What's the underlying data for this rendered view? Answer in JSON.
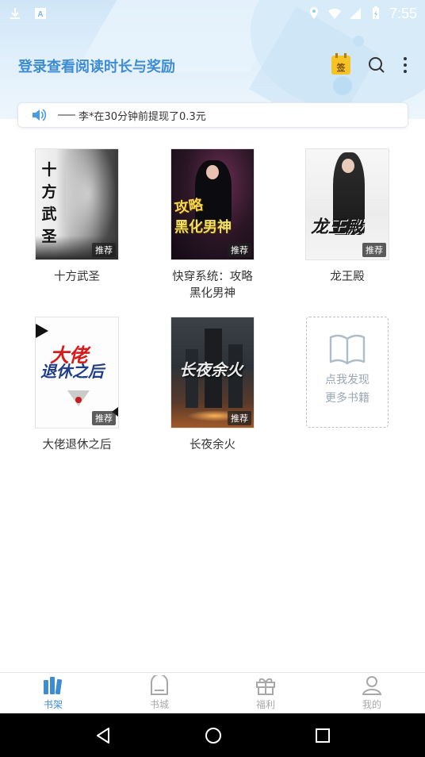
{
  "status_bar": {
    "time": "7:55",
    "left_icons": [
      "download-icon",
      "a-icon"
    ],
    "right_icons": [
      "location-icon",
      "wifi-icon",
      "signal-icon",
      "battery-icon"
    ]
  },
  "header": {
    "title": "登录查看阅读时长与奖励",
    "sign_label": "签",
    "actions": [
      "sign-in-icon",
      "search-icon",
      "more-icon"
    ]
  },
  "notice": {
    "text": "李*在30分钟前提现了0.3元",
    "icon": "speaker-icon"
  },
  "books": [
    {
      "title": "十方武圣",
      "badge": "推荐",
      "cover_text": "十方武圣"
    },
    {
      "title": "快穿系统：攻略\n黑化男神",
      "badge": "推荐",
      "cover_text_1": "攻略",
      "cover_text_2": "黑化男神"
    },
    {
      "title": "龙王殿",
      "badge": "推荐",
      "cover_text": "龙王殿"
    },
    {
      "title": "大佬退休之后",
      "badge": "推荐",
      "cover_text_1": "大佬",
      "cover_text_2": "退休之后"
    },
    {
      "title": "长夜余火",
      "badge": "推荐",
      "cover_text": "长夜余火"
    }
  ],
  "discover": {
    "line1": "点我发现",
    "line2": "更多书籍"
  },
  "bottom_nav": [
    {
      "label": "书架",
      "icon": "bookshelf-icon",
      "active": true
    },
    {
      "label": "书城",
      "icon": "bookstore-icon",
      "active": false
    },
    {
      "label": "福利",
      "icon": "gift-icon",
      "active": false
    },
    {
      "label": "我的",
      "icon": "profile-icon",
      "active": false
    }
  ],
  "colors": {
    "accent": "#3e8cd3",
    "inactive": "#a8a8a8",
    "badge_bg": "#f7c325"
  }
}
